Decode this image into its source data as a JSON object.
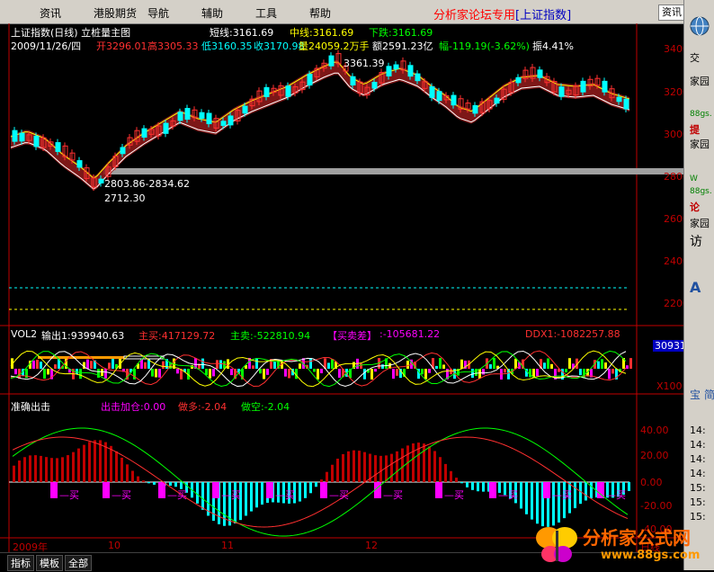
{
  "menubar": {
    "items": [
      "资讯",
      "港股期货",
      "导航",
      "辅助",
      "工具",
      "帮助"
    ],
    "banner_text": "分析家论坛专用",
    "banner_sub": "[上证指数]",
    "top_button": "资讯"
  },
  "main_chart": {
    "title": "上证指数(日线) 立桩量主图",
    "short_line": "短线:3161.69",
    "mid_line": "中线:3161.69",
    "down_line": "下跌:3161.69",
    "date": "2009/11/26/四",
    "open": "开3296.01",
    "high": "高3305.33",
    "low": "低3160.35",
    "close": "收3170.98",
    "volume": "量24059.2万手",
    "amount": "额2591.23亿",
    "change": "幅-119.19(-3.62%)",
    "amplitude": "振4.41%",
    "peak_label": "3361.39",
    "range_label": "2803.86-2834.62",
    "low_label": "2712.30",
    "y_axis": [
      "3400",
      "3200",
      "3000",
      "2800",
      "2600",
      "2400",
      "2200"
    ]
  },
  "vol_panel": {
    "name": "VOL2",
    "output": "输出1:939940.63",
    "main_buy": "主买:417129.72",
    "main_sell": "主卖:-522810.94",
    "buy_sell_diff_label": "【买卖差】",
    "buy_sell_diff_value": ":-105681.22",
    "ddx": "DDX1:-1082257.88",
    "right_value": "30931",
    "right_unit": "X100"
  },
  "bottom_panel": {
    "name": "准确出击",
    "attack_add": "出击加仓:0.00",
    "long": "做多:-2.04",
    "short": "做空:-2.04",
    "y_axis": [
      "40.00",
      "20.00",
      "0.00",
      "-20.00",
      "-40.00"
    ],
    "buy_label": "买"
  },
  "time_axis": [
    "2009年",
    "10",
    "11",
    "12",
    "日线"
  ],
  "tabs": [
    "指标",
    "模板",
    "全部"
  ],
  "right_panel": {
    "items": [
      "交",
      "家园",
      "提",
      "家园",
      "W",
      "论",
      "家园",
      "访"
    ],
    "sites": [
      "88gs.",
      "88gs.",
      "88gs."
    ],
    "letters": [
      "A",
      "宝",
      "简"
    ],
    "times": [
      "14:",
      "14:",
      "14:",
      "14:",
      "15:",
      "15:",
      "15:"
    ]
  },
  "logo": {
    "text": "分析家公式网",
    "url": "www.88gs.com"
  },
  "colors": {
    "up": "#ff3030",
    "down": "#00ffff",
    "magenta": "#ff00ff",
    "yellow": "#ffff00",
    "green": "#00ff00",
    "accent_red": "#c00000"
  }
}
